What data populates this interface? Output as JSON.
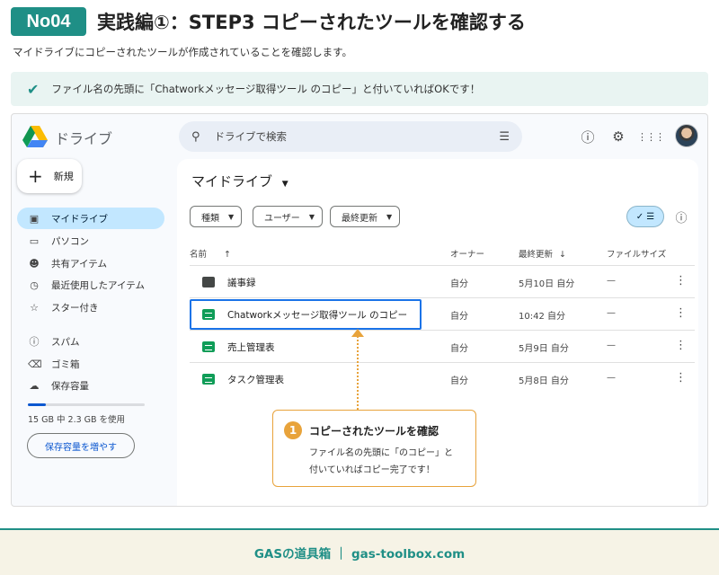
{
  "header": {
    "step_badge": "No04",
    "title": "実践編①：STEP3 コピーされたツールを確認する",
    "subtitle": "マイドライブにコピーされたツールが作成されていることを確認します。",
    "tip": "ファイル名の先頭に「Chatworkメッセージ取得ツール のコピー」と付いていればOKです！"
  },
  "drive": {
    "app_name": "ドライブ",
    "search_placeholder": "ドライブで検索",
    "new_button": "新規",
    "nav": [
      {
        "label": "マイドライブ",
        "icon": "my-drive-icon",
        "active": true
      },
      {
        "label": "パソコン",
        "icon": "computer-icon",
        "active": false
      },
      {
        "label": "共有アイテム",
        "icon": "shared-icon",
        "active": false
      },
      {
        "label": "最近使用したアイテム",
        "icon": "recent-icon",
        "active": false
      },
      {
        "label": "スター付き",
        "icon": "star-icon",
        "active": false
      },
      {
        "label": "スパム",
        "icon": "spam-icon",
        "active": false
      },
      {
        "label": "ゴミ箱",
        "icon": "trash-icon",
        "active": false
      },
      {
        "label": "保存容量",
        "icon": "cloud-icon",
        "active": false
      }
    ],
    "storage_text": "15 GB 中 2.3 GB を使用",
    "storage_used_fraction": 0.15,
    "storage_button": "保存容量を増やす",
    "main_title": "マイドライブ",
    "filters": [
      "種類",
      "ユーザー",
      "最終更新"
    ],
    "columns": {
      "name": "名前",
      "owner": "オーナー",
      "modified": "最終更新",
      "size": "ファイルサイズ"
    },
    "files": [
      {
        "name": "議事録",
        "type": "folder",
        "owner": "自分",
        "modified": "5月10日 自分",
        "size": "—"
      },
      {
        "name": "Chatworkメッセージ取得ツール のコピー",
        "type": "sheet",
        "owner": "自分",
        "modified": "10:42 自分",
        "size": "—"
      },
      {
        "name": "売上管理表",
        "type": "sheet",
        "owner": "自分",
        "modified": "5月9日 自分",
        "size": "—"
      },
      {
        "name": "タスク管理表",
        "type": "sheet",
        "owner": "自分",
        "modified": "5月8日 自分",
        "size": "—"
      }
    ]
  },
  "callout": {
    "number": "1",
    "title": "コピーされたツールを確認",
    "body_line1": "ファイル名の先頭に「のコピー」と",
    "body_line2": "付いていればコピー完了です！"
  },
  "footer": "GASの道具箱 ｜ gas-toolbox.com",
  "colors": {
    "accent": "#1f8f86",
    "highlight": "#1a73e8",
    "callout": "#e8a33b",
    "nav_active": "#c2e7ff"
  }
}
